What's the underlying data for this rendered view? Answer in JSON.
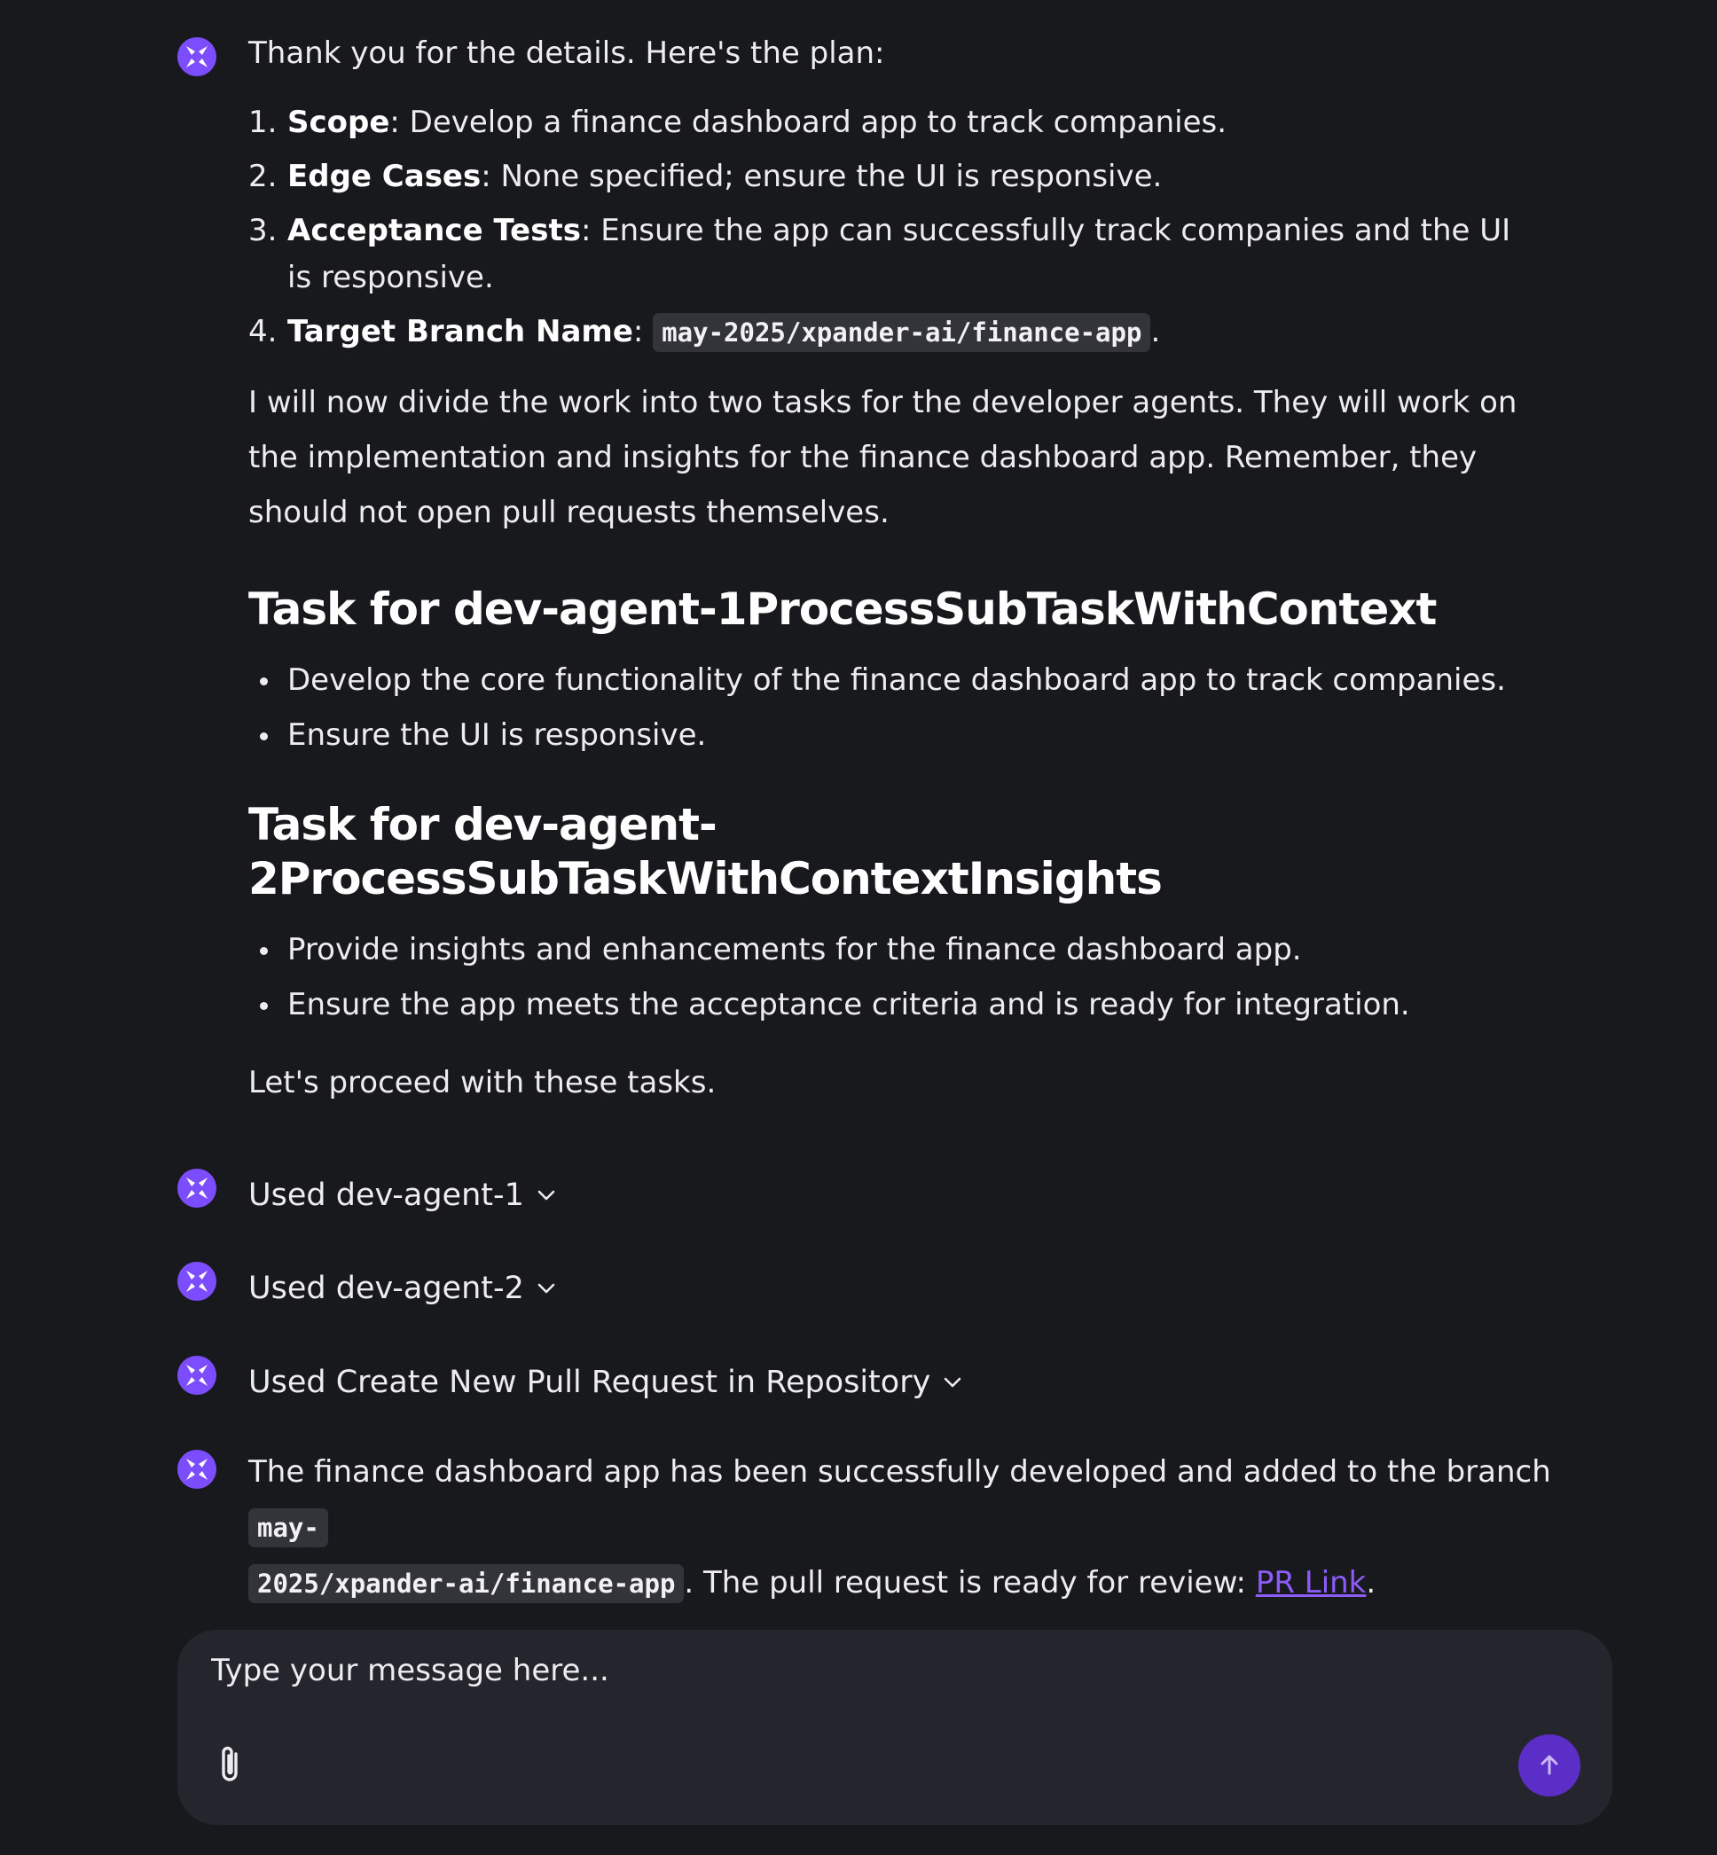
{
  "colors": {
    "background": "#18191c",
    "accent": "#7c4dff",
    "link": "#8b5cf6",
    "composer_bg": "#25252e",
    "send_button": "#5b2ec7"
  },
  "message1": {
    "intro": "Thank you for the details. Here's the plan:",
    "plan": [
      {
        "num": "1.",
        "title": "Scope",
        "text": ": Develop a finance dashboard app to track companies."
      },
      {
        "num": "2.",
        "title": "Edge Cases",
        "text": ": None specified; ensure the UI is responsive."
      },
      {
        "num": "3.",
        "title": "Acceptance Tests",
        "text": ": Ensure the app can successfully track companies and the UI is responsive."
      },
      {
        "num": "4.",
        "title": "Target Branch Name",
        "text": ": ",
        "code": "may-2025/xpander-ai/finance-app",
        "suffix": "."
      }
    ],
    "paragraph": "I will now divide the work into two tasks for the developer agents. They will work on the implementation and insights for the finance dashboard app. Remember, they should not open pull requests themselves.",
    "task1": {
      "heading": "Task for dev-agent-1ProcessSubTaskWithContext",
      "bullets": [
        "Develop the core functionality of the finance dashboard app to track companies.",
        "Ensure the UI is responsive."
      ]
    },
    "task2": {
      "heading": "Task for dev-agent-2ProcessSubTaskWithContextInsights",
      "bullets": [
        "Provide insights and enhancements for the finance dashboard app.",
        "Ensure the app meets the acceptance criteria and is ready for integration."
      ]
    },
    "closing": "Let's proceed with these tasks."
  },
  "tool_calls": [
    {
      "label": "Used dev-agent-1",
      "icon": "chevron-down-icon"
    },
    {
      "label": "Used dev-agent-2",
      "icon": "chevron-down-icon"
    },
    {
      "label": "Used Create New Pull Request in Repository",
      "icon": "chevron-down-icon"
    }
  ],
  "final_message": {
    "text_before": "The finance dashboard app has been successfully developed and added to the branch ",
    "code_part1": "may-",
    "code_part2": "2025/xpander-ai/finance-app",
    "text_after": ". The pull request is ready for review: ",
    "link_text": "PR Link",
    "end": "."
  },
  "composer": {
    "placeholder": "Type your message here...",
    "attach_icon": "paperclip-icon",
    "send_icon": "arrow-up-icon"
  }
}
